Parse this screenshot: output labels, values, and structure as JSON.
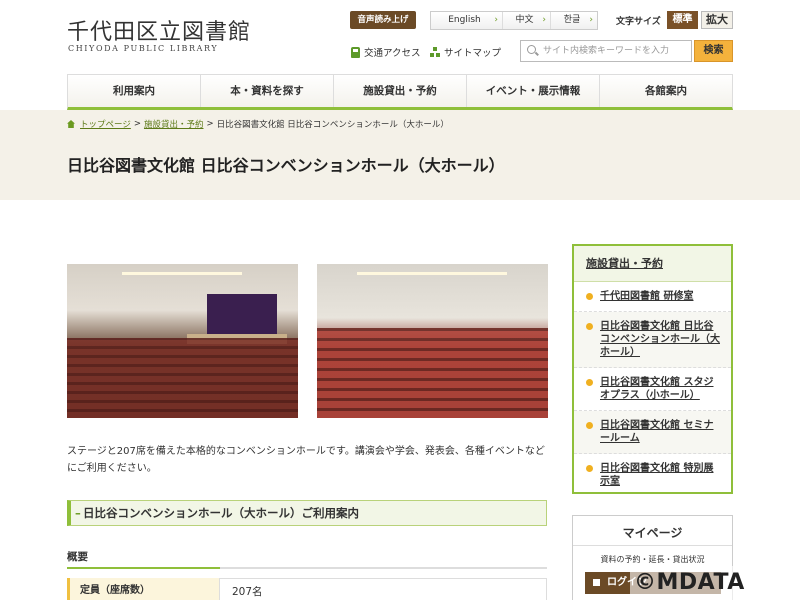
{
  "header": {
    "title": "千代田区立図書館",
    "subtitle": "CHIYODA PUBLIC LIBRARY",
    "voice_label": "音声読み上げ",
    "languages": [
      "English",
      "中文",
      "한글"
    ],
    "font_size_label": "文字サイズ",
    "font_std": "標準",
    "font_big": "拡大",
    "traffic": "交通アクセス",
    "sitemap": "サイトマップ",
    "search_placeholder": "サイト内検索キーワードを入力",
    "search_button": "検索"
  },
  "nav": [
    "利用案内",
    "本・資料を探す",
    "施設貸出・予約",
    "イベント・展示情報",
    "各館案内"
  ],
  "breadcrumb": {
    "home": "トップページ",
    "sep": ">",
    "level1": "施設貸出・予約",
    "current": "日比谷図書文化館 日比谷コンベンションホール（大ホール）"
  },
  "page_title": "日比谷図書文化館 日比谷コンベンションホール（大ホール）",
  "description": "ステージと207席を備えた本格的なコンベンションホールです。講演会や学会、発表会、各種イベントなどにご利用ください。",
  "section_title": "日比谷コンベンションホール（大ホール）ご利用案内",
  "overview": {
    "heading": "概要",
    "label": "定員（座席数）",
    "value": "207名"
  },
  "sidebar": {
    "heading": "施設貸出・予約",
    "items": [
      "千代田図書館 研修室",
      "日比谷図書文化館 日比谷コンベンションホール（大ホール）",
      "日比谷図書文化館 スタジオプラス（小ホール）",
      "日比谷図書文化館 セミナールーム",
      "日比谷図書文化館 特別展示室"
    ]
  },
  "mypage": {
    "title": "マイページ",
    "sub": "資料の予約・延長・貸出状況",
    "login": "ログイン"
  },
  "watermark": "©MDATA"
}
